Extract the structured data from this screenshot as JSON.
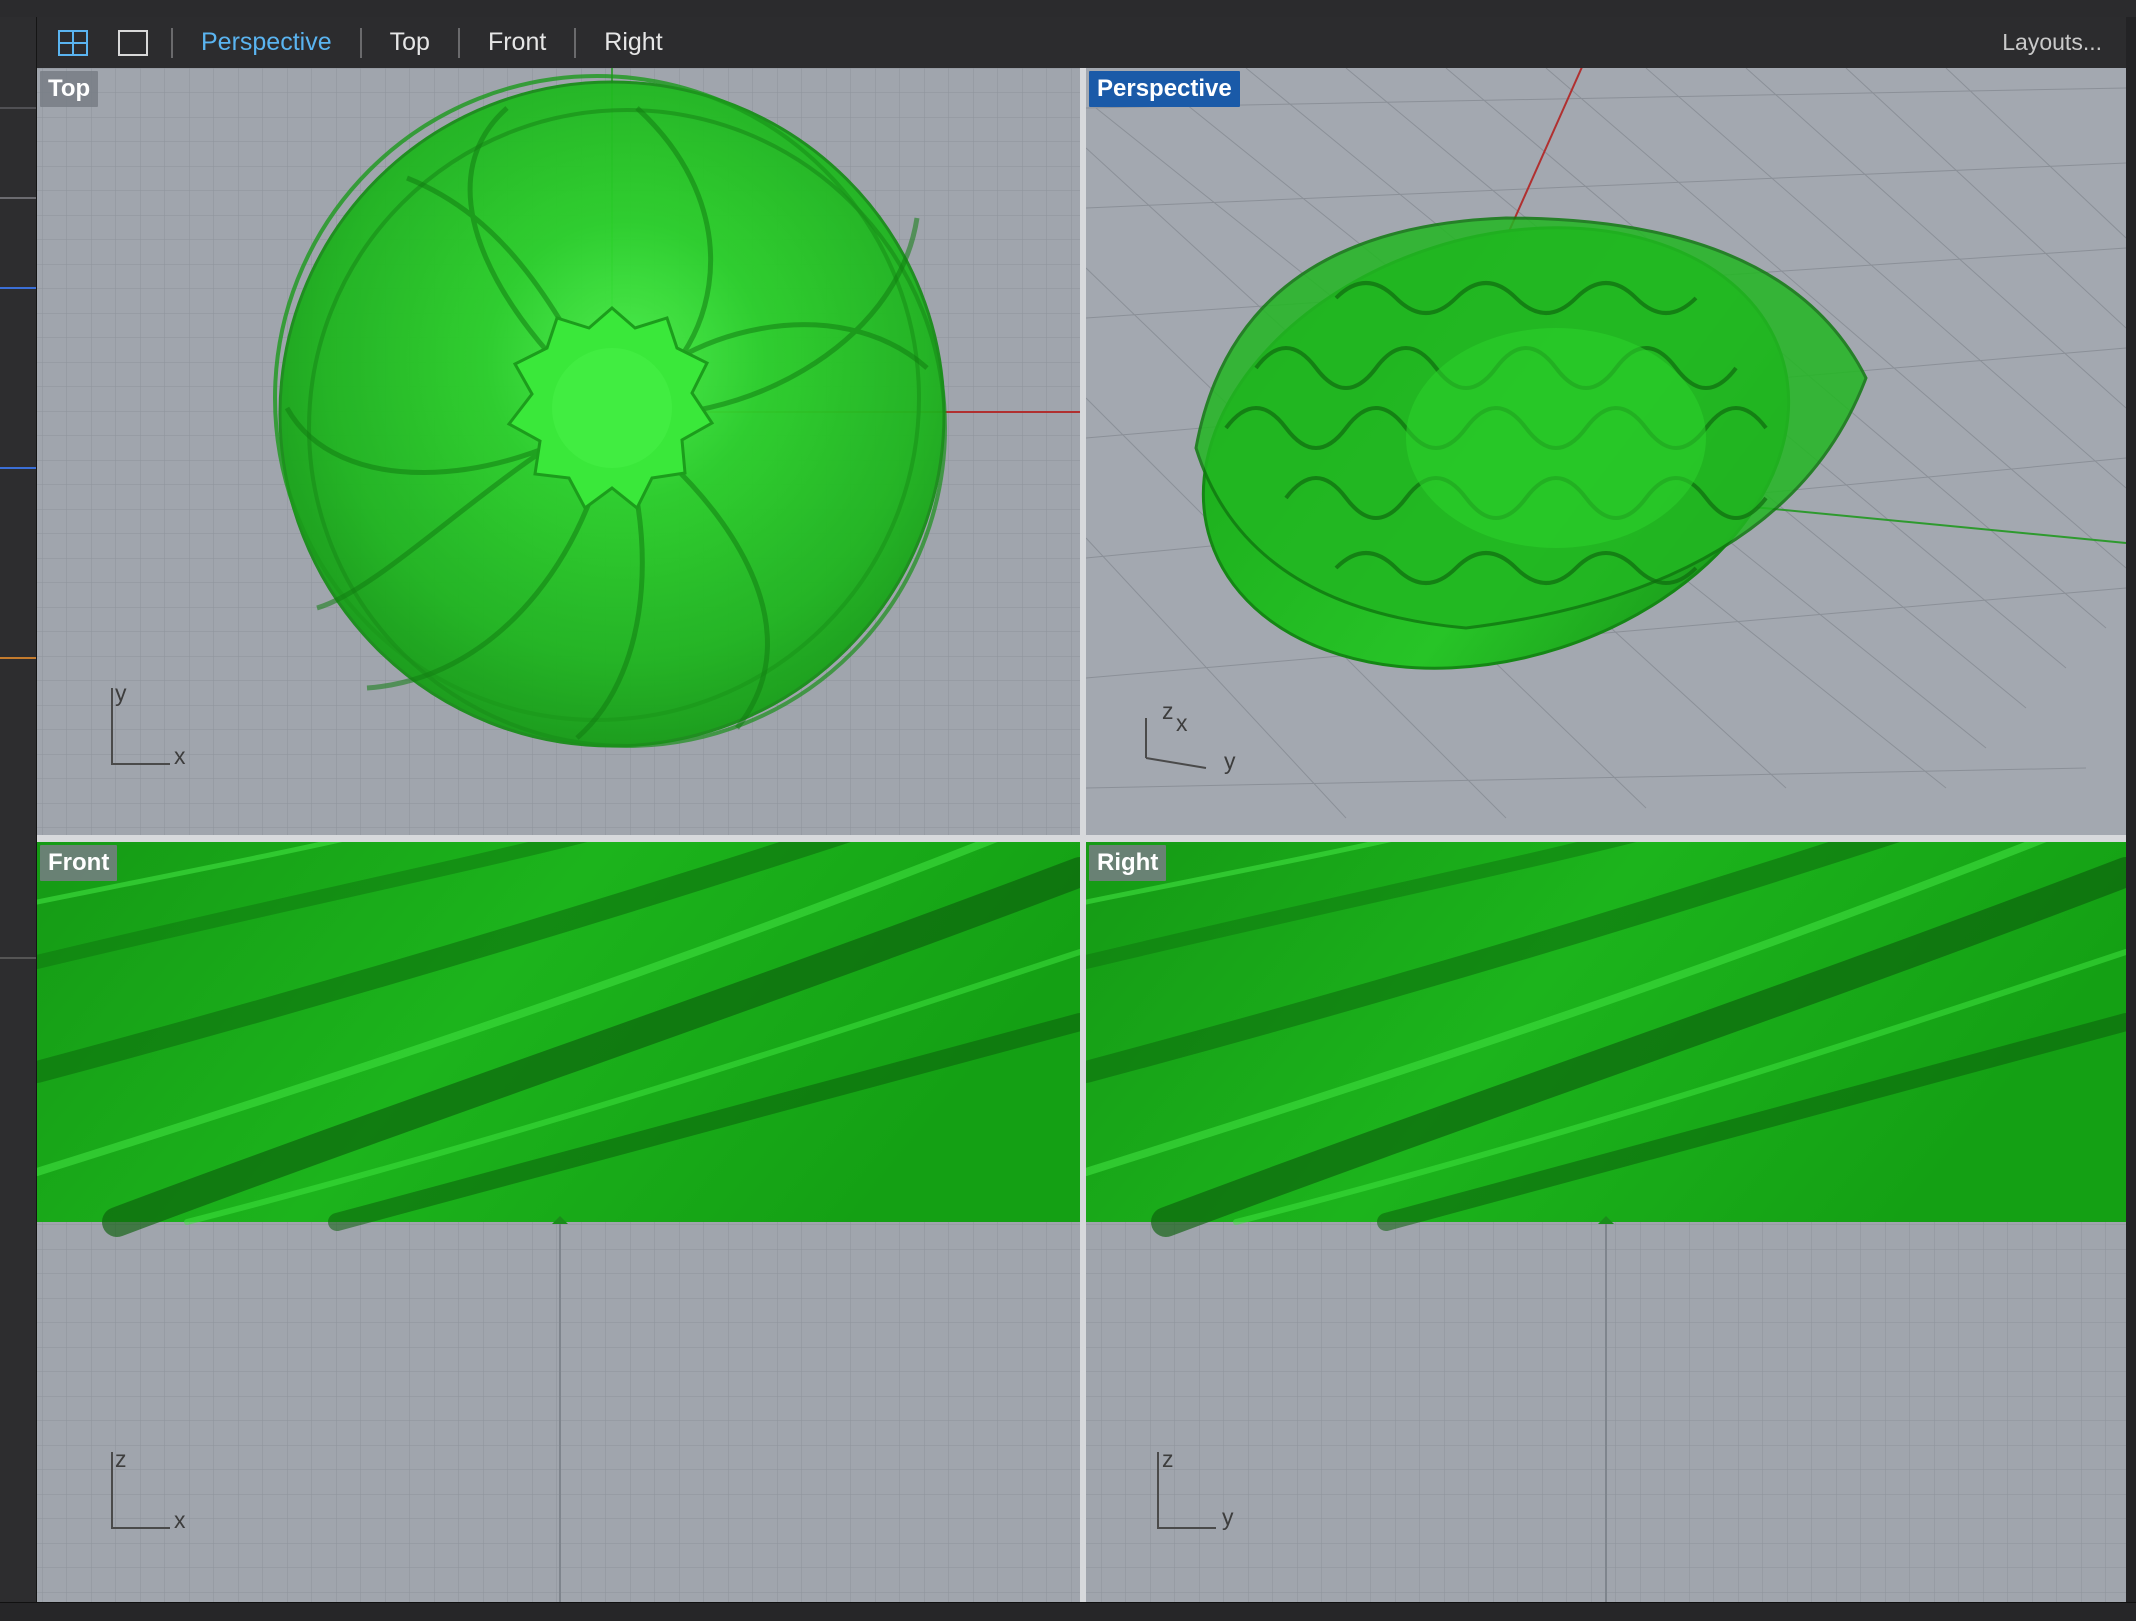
{
  "toolbar": {
    "icons": [
      "four-viewports-icon",
      "single-viewport-icon"
    ],
    "tabs": [
      "Perspective",
      "Top",
      "Front",
      "Right"
    ],
    "active_tab": "Perspective",
    "layouts_label": "Layouts..."
  },
  "viewports": {
    "top": {
      "label": "Top",
      "axis_v": "y",
      "axis_h": "x"
    },
    "perspective": {
      "label": "Perspective",
      "axis_v": "z",
      "axis_h": "y",
      "axis_x": "x"
    },
    "front": {
      "label": "Front",
      "axis_v": "z",
      "axis_h": "x"
    },
    "right": {
      "label": "Right",
      "axis_v": "z",
      "axis_h": "y"
    }
  },
  "colors": {
    "active_tab": "#5ab4f0",
    "active_label_bg": "#1a5aa8",
    "viewport_bg": "#a0a5ad",
    "model_green": "#1fb51f",
    "x_axis": "#b03030",
    "y_axis": "#2e9a2e"
  }
}
